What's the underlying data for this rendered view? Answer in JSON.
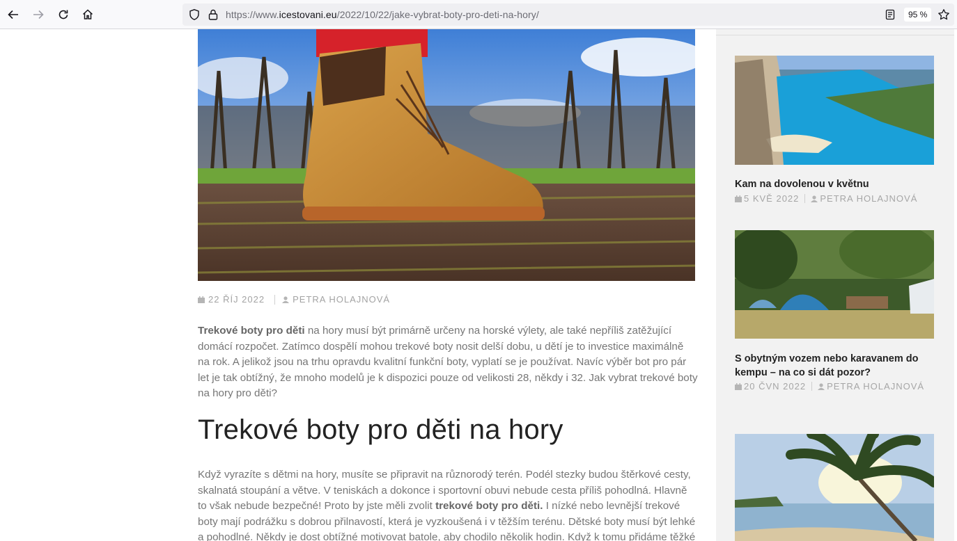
{
  "browser": {
    "url_prefix": "https://www.",
    "url_domain": "icestovani.eu",
    "url_path": "/2022/10/22/jake-vybrat-boty-pro-deti-na-hory/",
    "zoom": "95 %"
  },
  "article": {
    "date": "22 ŘÍJ 2022",
    "author": "PETRA HOLAJNOVÁ",
    "p1_bold": "Trekové boty pro děti",
    "p1_rest": " na hory musí být primárně určeny na horské výlety, ale také nepříliš zatěžující domácí rozpočet. Zatímco dospělí mohou trekové boty nosit delší dobu, u dětí je to investice maximálně na rok. A jelikož jsou na trhu opravdu kvalitní funkční boty, vyplatí se je používat. Navíc výběr bot pro pár let je tak obtížný, že mnoho modelů je k dispozici pouze od velikosti 28, někdy i 32. Jak vybrat trekové boty na hory pro děti?",
    "heading": "Trekové boty pro děti na hory",
    "p2_start": "Když vyrazíte s dětmi na hory, musíte se připravit na různorodý terén. Podél stezky budou štěrkové cesty, skalnatá stoupání a větve. V teniskách a dokonce i sportovní obuvi nebude cesta příliš pohodlná. Hlavně to však nebude bezpečné! Proto by jste měli zvolit ",
    "p2_bold": "trekové boty pro děti.",
    "p2_rest": " I nízké nebo levnější trekové boty mají podrážku s dobrou přilnavostí, která je vyzkoušená i v těžším terénu. Dětské boty musí být lehké a pohodlné. Někdy je dost obtížné motivovat batole, aby chodilo několik hodin. Když k tomu přidáme těžké a"
  },
  "sidebar": {
    "posts": [
      {
        "title": "Kam na dovolenou v květnu",
        "date": "5 KVĚ 2022",
        "author": "PETRA HOLAJNOVÁ"
      },
      {
        "title": "S obytným vozem nebo karavanem do kempu – na co si dát pozor?",
        "date": "20 ČVN 2022",
        "author": "PETRA HOLAJNOVÁ"
      }
    ]
  },
  "colors": {
    "accent_text": "#222222",
    "muted": "#a3a3a3",
    "sidebar_bg": "#f2f2f2"
  }
}
